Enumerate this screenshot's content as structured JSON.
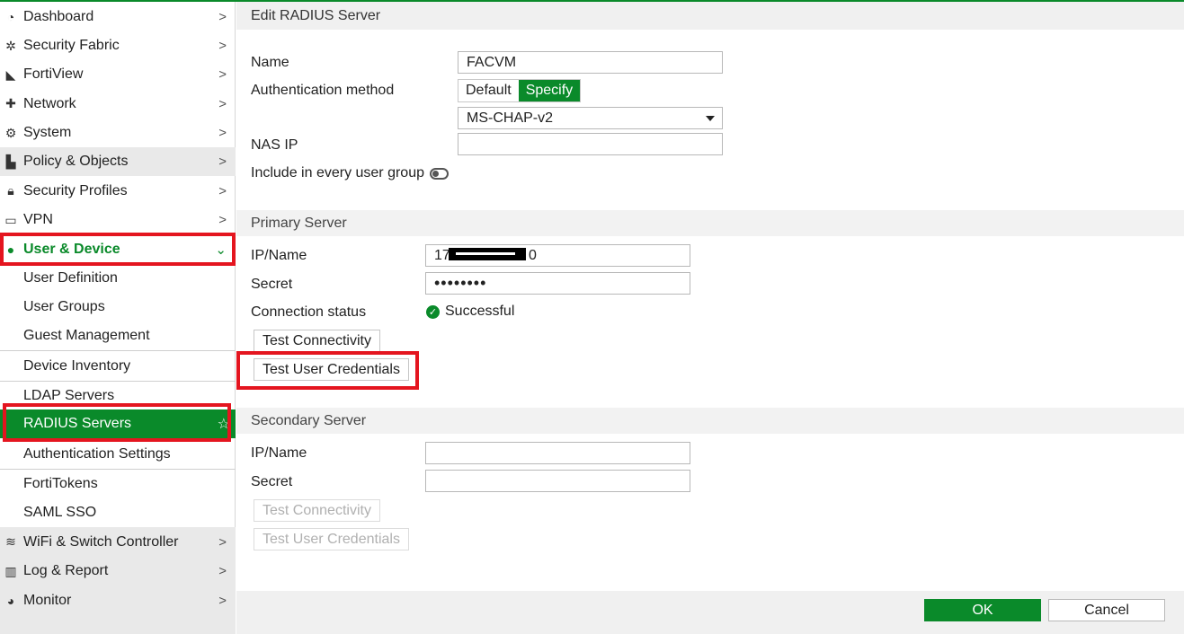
{
  "sidebar": {
    "items": [
      {
        "label": "Dashboard",
        "icon": "dashboard-icon"
      },
      {
        "label": "Security Fabric",
        "icon": "security-fabric-icon"
      },
      {
        "label": "FortiView",
        "icon": "fortiview-icon"
      },
      {
        "label": "Network",
        "icon": "network-icon"
      },
      {
        "label": "System",
        "icon": "gear-icon"
      },
      {
        "label": "Policy & Objects",
        "icon": "policy-icon"
      },
      {
        "label": "Security Profiles",
        "icon": "lock-icon"
      },
      {
        "label": "VPN",
        "icon": "laptop-icon"
      },
      {
        "label": "User & Device",
        "icon": "user-icon"
      }
    ],
    "user_device_subitems": [
      "User Definition",
      "User Groups",
      "Guest Management",
      "Device Inventory",
      "LDAP Servers",
      "RADIUS Servers",
      "Authentication Settings",
      "FortiTokens",
      "SAML SSO"
    ],
    "bottom_items": [
      {
        "label": "WiFi & Switch Controller",
        "icon": "wifi-icon"
      },
      {
        "label": "Log & Report",
        "icon": "bar-chart-icon"
      },
      {
        "label": "Monitor",
        "icon": "pie-chart-icon"
      }
    ],
    "chevron": ">",
    "chevron_open": "⌄"
  },
  "form": {
    "title": "Edit RADIUS Server",
    "name_label": "Name",
    "name_value": "FACVM",
    "auth_method_label": "Authentication method",
    "auth_options": [
      "Default",
      "Specify"
    ],
    "auth_selected": "Specify",
    "auth_protocol": "MS-CHAP-v2",
    "nas_ip_label": "NAS IP",
    "nas_ip_value": "",
    "include_label": "Include in every user group",
    "include_enabled": false
  },
  "primary": {
    "section_title": "Primary Server",
    "ip_label": "IP/Name",
    "ip_value_start": "17",
    "ip_value_end": "0",
    "secret_label": "Secret",
    "secret_value": "••••••••",
    "status_label": "Connection status",
    "status_value": "Successful",
    "test_connectivity": "Test Connectivity",
    "test_credentials": "Test User Credentials"
  },
  "secondary": {
    "section_title": "Secondary Server",
    "ip_label": "IP/Name",
    "ip_value": "",
    "secret_label": "Secret",
    "secret_value": "",
    "test_connectivity": "Test Connectivity",
    "test_credentials": "Test User Credentials"
  },
  "footer": {
    "ok": "OK",
    "cancel": "Cancel"
  },
  "colors": {
    "accent": "#0a8a2a",
    "highlight_box": "#e4151f"
  }
}
